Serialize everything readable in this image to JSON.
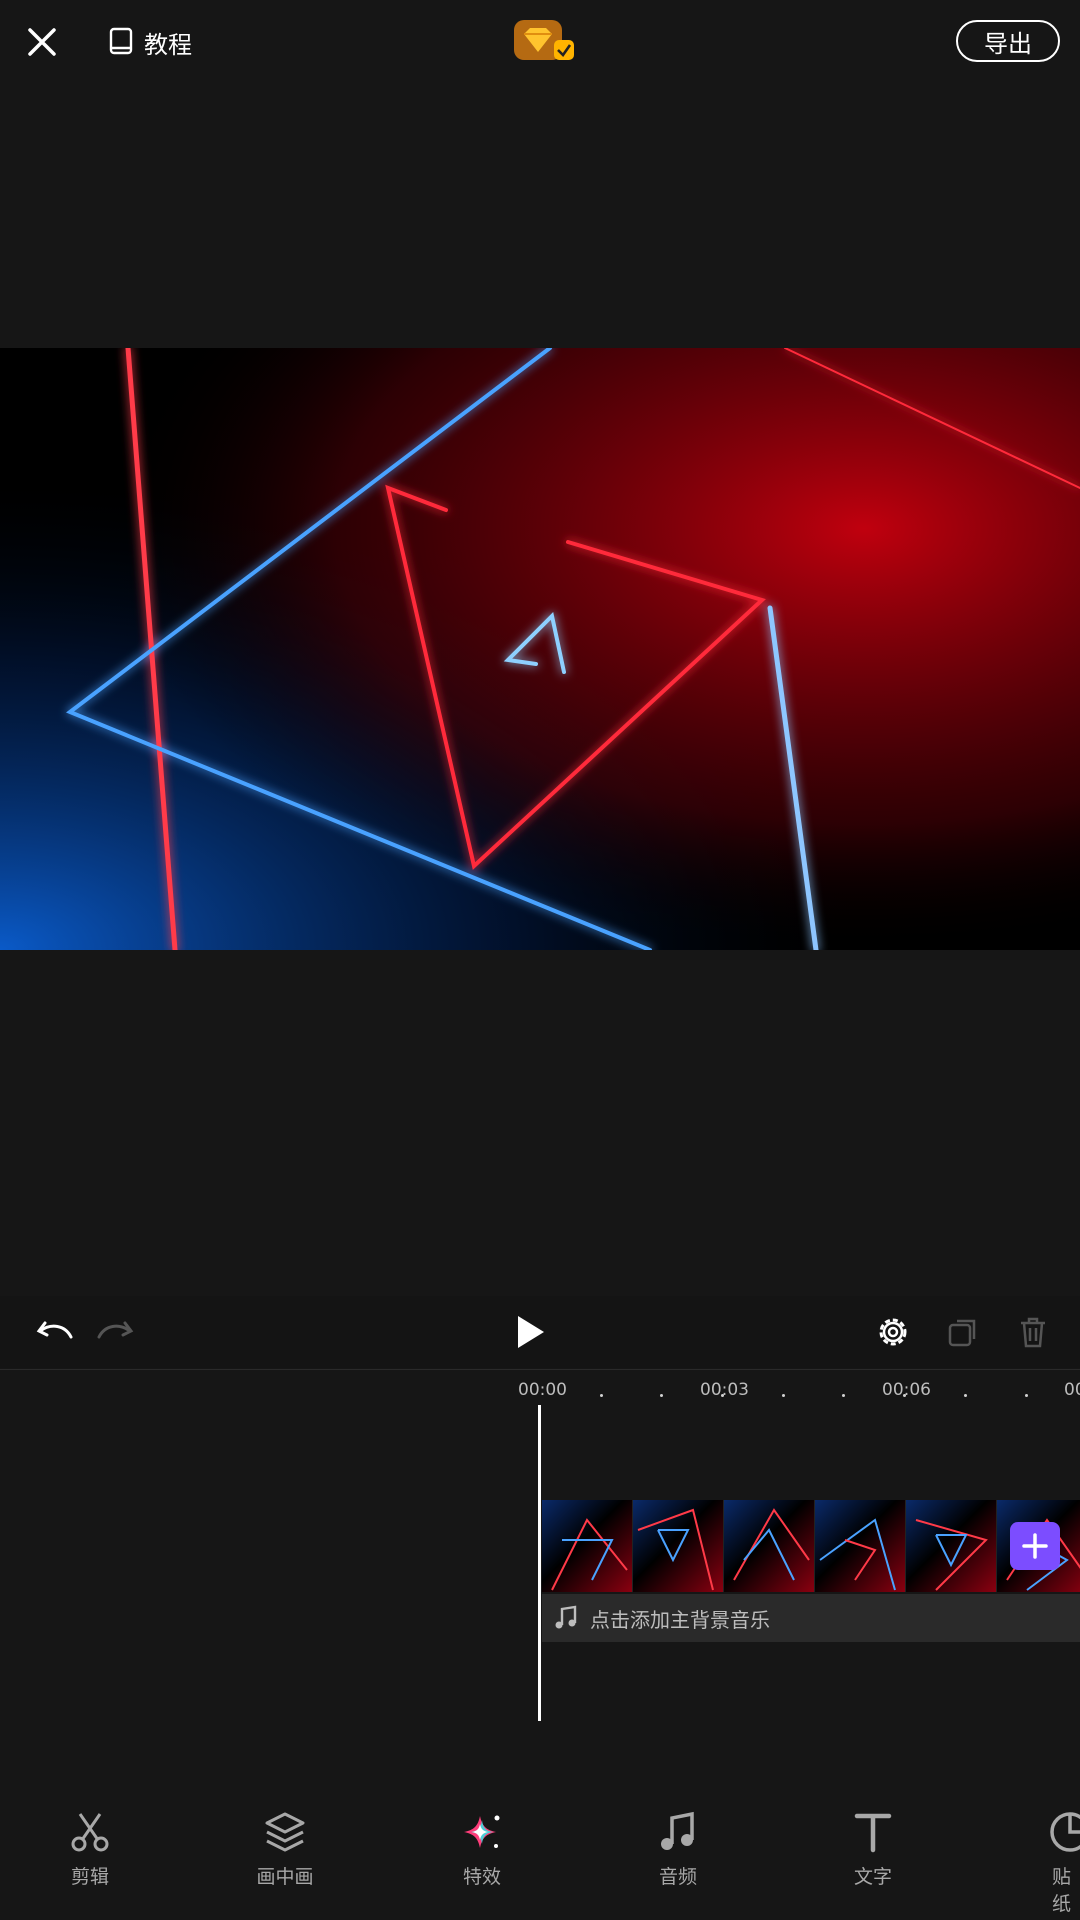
{
  "header": {
    "close_icon": "close-icon",
    "tutorial_label": "教程",
    "export_label": "导出"
  },
  "timeline": {
    "ticks": [
      "00:00",
      "00:03",
      "00:06",
      "00"
    ],
    "music_prompt": "点击添加主背景音乐"
  },
  "bottom_nav": [
    {
      "label": "剪辑",
      "icon": "scissors-icon"
    },
    {
      "label": "画中画",
      "icon": "layers-icon"
    },
    {
      "label": "特效",
      "icon": "sparkles-icon"
    },
    {
      "label": "音频",
      "icon": "music-note-icon"
    },
    {
      "label": "文字",
      "icon": "text-icon"
    },
    {
      "label": "贴纸",
      "icon": "sticker-icon"
    }
  ],
  "colors": {
    "background": "#161616",
    "accent": "#7c4dff",
    "neon_red": "#ff2a3a",
    "neon_blue": "#2f8cff"
  }
}
